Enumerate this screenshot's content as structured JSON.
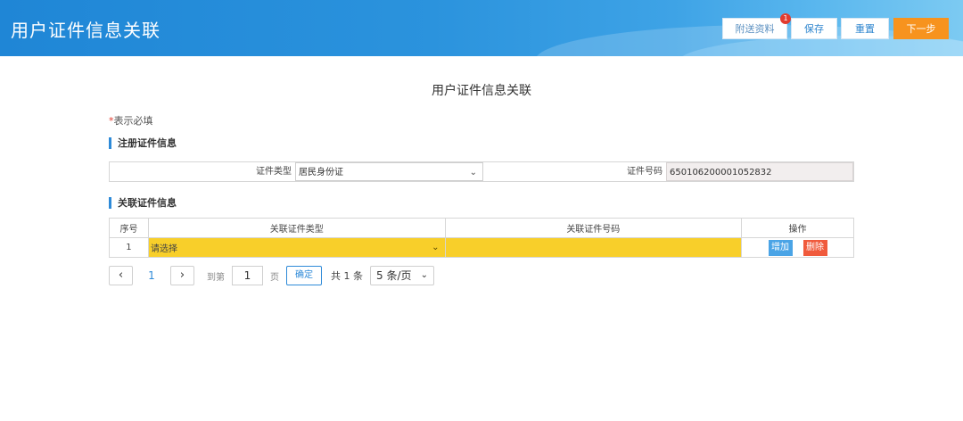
{
  "header": {
    "title": "用户证件信息关联",
    "buttons": {
      "send_materials": "附送资料",
      "send_badge": "1",
      "save": "保存",
      "reset": "重置",
      "next": "下一步"
    }
  },
  "page_title": "用户证件信息关联",
  "required_note": {
    "star": "*",
    "text": "表示必填"
  },
  "sections": {
    "registered": "注册证件信息",
    "linked": "关联证件信息"
  },
  "registered_cert": {
    "type_label": "证件类型",
    "type_value": "居民身份证",
    "number_label": "证件号码",
    "number_value": "650106200001052832"
  },
  "linked_table": {
    "headers": [
      "序号",
      "关联证件类型",
      "关联证件号码",
      "操作"
    ],
    "rows": [
      {
        "index": "1",
        "type_placeholder": "请选择",
        "number": "",
        "add": "增加",
        "delete": "删除"
      }
    ]
  },
  "pagination": {
    "current_page": "1",
    "goto_label": "到第",
    "goto_value": "1",
    "page_unit": "页",
    "confirm": "确定",
    "total": "共 1 条",
    "page_size": "5 条/页"
  },
  "colors": {
    "header_blue": "#1f86d6",
    "next_orange": "#f7931e",
    "highlight_yellow": "#f8cf2a",
    "add_blue": "#4aa4e6",
    "delete_red": "#f05a3c"
  },
  "icons": {
    "dropdown": "chevron-down-icon",
    "prev": "chevron-left-icon",
    "next": "chevron-right-icon"
  }
}
